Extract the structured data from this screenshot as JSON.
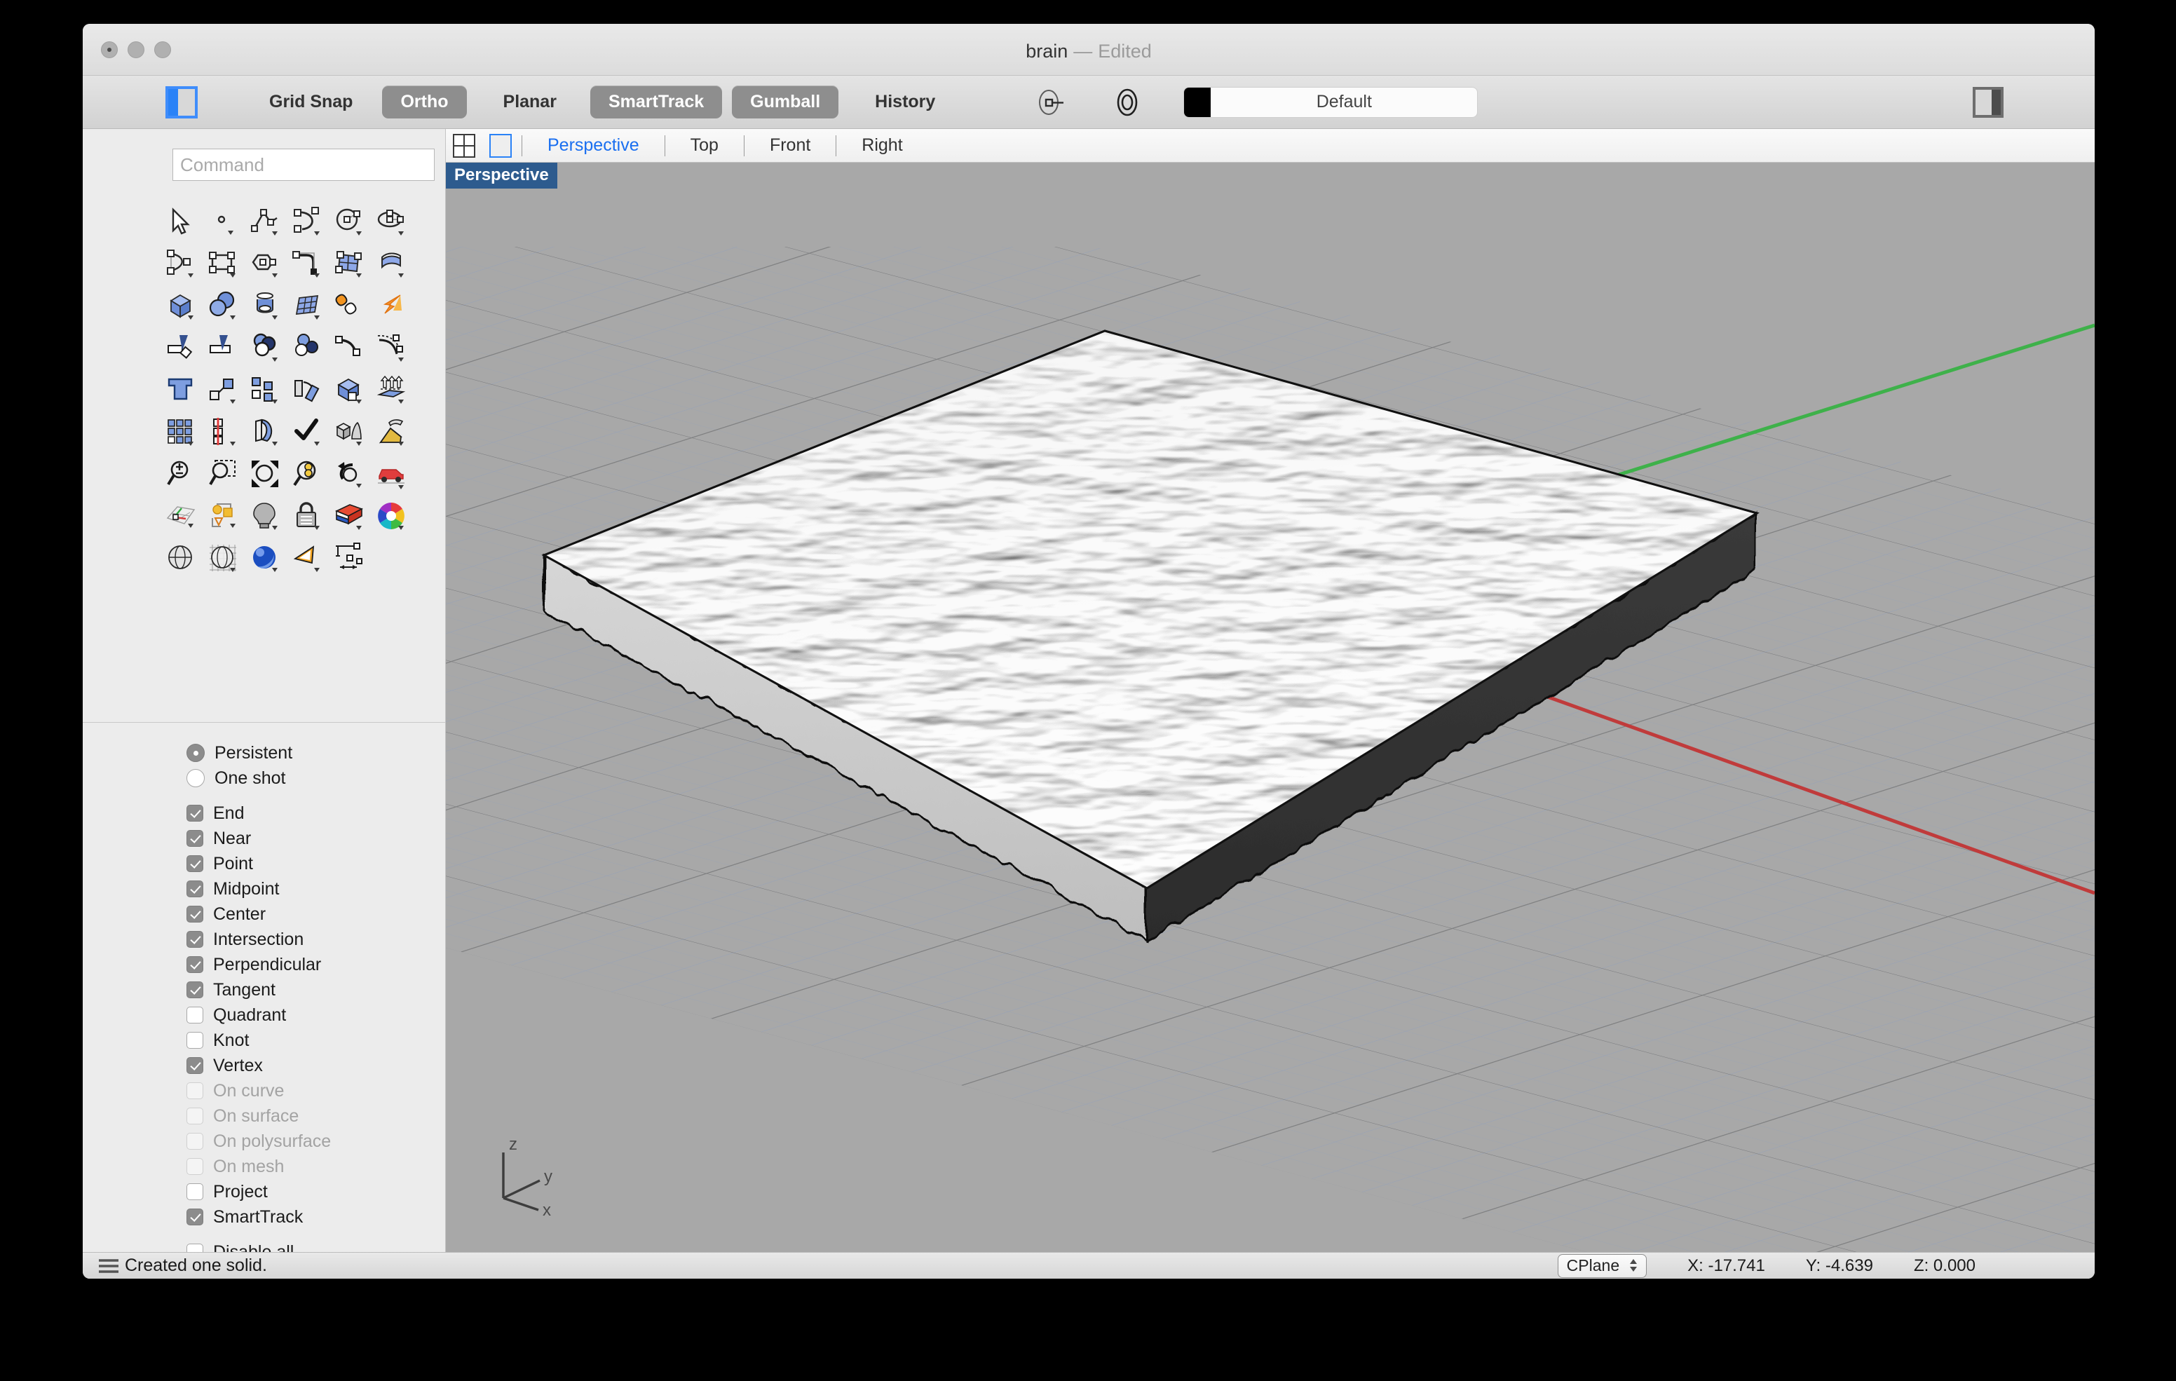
{
  "window": {
    "title_doc": "brain",
    "title_sep": "—",
    "title_state": "Edited",
    "traffic_close": "close-button",
    "traffic_minimize": "minimize-button",
    "traffic_zoom": "zoom-button"
  },
  "toolbar": {
    "left_panel_toggle": "left-sidebar-toggle",
    "right_panel_toggle": "right-sidebar-toggle",
    "items": [
      {
        "label": "Grid Snap",
        "active": false
      },
      {
        "label": "Ortho",
        "active": true
      },
      {
        "label": "Planar",
        "active": false
      },
      {
        "label": "SmartTrack",
        "active": true
      },
      {
        "label": "Gumball",
        "active": true
      },
      {
        "label": "History",
        "active": false
      }
    ],
    "icons": [
      "record-history-icon",
      "osnap-target-icon"
    ],
    "layer": {
      "name": "Default",
      "color": "#000000"
    }
  },
  "viewport_tabs": {
    "layout_four_icon": "four-view-layout-icon",
    "layout_single_icon": "single-view-layout-icon",
    "tabs": [
      {
        "label": "Perspective",
        "active": true
      },
      {
        "label": "Top",
        "active": false
      },
      {
        "label": "Front",
        "active": false
      },
      {
        "label": "Right",
        "active": false
      }
    ]
  },
  "sidebar": {
    "command": {
      "placeholder": "Command",
      "value": ""
    },
    "tools": [
      "select-arrow-icon",
      "point-icon",
      "polyline-icon",
      "arc-icon",
      "circle-icon",
      "ellipse-icon",
      "curve-icon",
      "rectangle-icon",
      "polygon-icon",
      "fillet-curve-icon",
      "surface-from-curves-icon",
      "extrude-surface-icon",
      "box-icon",
      "sphere-boolean-icon",
      "torus-icon",
      "surface-grid-icon",
      "boolean-union-icon",
      "explode-icon",
      "trim-icon",
      "split-icon",
      "boolean-difference-icon",
      "boolean-union-circles-icon",
      "offset-curve-icon",
      "offset-dashed-icon",
      "text-icon",
      "move-icon",
      "copy-icon",
      "rotate-icon",
      "box-edit-icon",
      "extrude-up-icon",
      "array-icon",
      "mirror-icon",
      "bend-icon",
      "check-icon",
      "solid-tools-icon",
      "render-icon",
      "zoom-in-out-icon",
      "zoom-window-icon",
      "zoom-extents-icon",
      "zoom-selected-icon",
      "undo-view-icon",
      "named-view-car-icon",
      "cplane-grid-icon",
      "select-objects-icon",
      "light-bulb-icon",
      "lock-icon",
      "render-color-icon",
      "color-wheel-icon",
      "shaded-view-icon",
      "ghosted-view-icon",
      "rendered-view-icon",
      "camera-icon",
      "dimension-icon"
    ],
    "osnap_mode": [
      {
        "label": "Persistent",
        "selected": true
      },
      {
        "label": "One shot",
        "selected": false
      }
    ],
    "osnaps": [
      {
        "label": "End",
        "checked": true,
        "disabled": false
      },
      {
        "label": "Near",
        "checked": true,
        "disabled": false
      },
      {
        "label": "Point",
        "checked": true,
        "disabled": false
      },
      {
        "label": "Midpoint",
        "checked": true,
        "disabled": false
      },
      {
        "label": "Center",
        "checked": true,
        "disabled": false
      },
      {
        "label": "Intersection",
        "checked": true,
        "disabled": false
      },
      {
        "label": "Perpendicular",
        "checked": true,
        "disabled": false
      },
      {
        "label": "Tangent",
        "checked": true,
        "disabled": false
      },
      {
        "label": "Quadrant",
        "checked": false,
        "disabled": false
      },
      {
        "label": "Knot",
        "checked": false,
        "disabled": false
      },
      {
        "label": "Vertex",
        "checked": true,
        "disabled": false
      },
      {
        "label": "On curve",
        "checked": false,
        "disabled": true
      },
      {
        "label": "On surface",
        "checked": false,
        "disabled": true
      },
      {
        "label": "On polysurface",
        "checked": false,
        "disabled": true
      },
      {
        "label": "On mesh",
        "checked": false,
        "disabled": true
      },
      {
        "label": "Project",
        "checked": false,
        "disabled": false
      },
      {
        "label": "SmartTrack",
        "checked": true,
        "disabled": false
      }
    ],
    "disable_all": {
      "label": "Disable all",
      "checked": false
    }
  },
  "viewport": {
    "label": "Perspective",
    "background": "#a8a8a8",
    "grid_minor_color": "#9aa3b4",
    "grid_major_color": "#8a8a8a",
    "y_axis_color": "#3eb14a",
    "x_axis_color": "#c03b3b",
    "axis_gizmo": {
      "z": "z",
      "y": "y",
      "x": "x"
    },
    "model": {
      "name": "wavy-gyroid-slab",
      "top_surface": "#f5f5f5",
      "side_dark": "#333333",
      "side_light": "#c8c8c8"
    }
  },
  "statusbar": {
    "menu_icon": "hamburger-icon",
    "message": "Created one solid.",
    "cplane_label": "CPlane",
    "x": "X: -17.741",
    "y": "Y: -4.639",
    "z": "Z: 0.000"
  }
}
